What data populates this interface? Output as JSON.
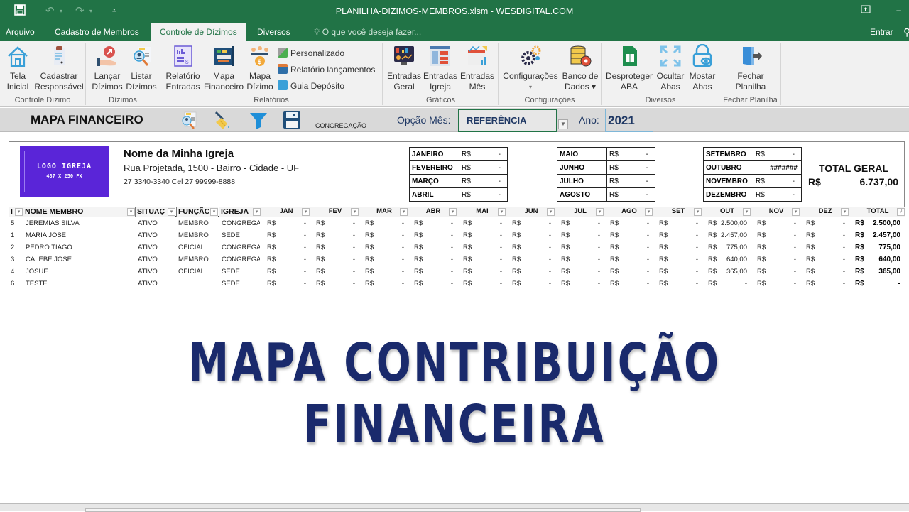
{
  "window": {
    "title": "PLANILHA-DIZIMOS-MEMBROS.xlsm - WESDIGITAL.COM",
    "qa_icons": [
      "save-icon",
      "undo-icon",
      "redo-icon",
      "customize-icon"
    ]
  },
  "tabs": [
    {
      "label": "Arquivo",
      "active": false
    },
    {
      "label": "Cadastro de Membros",
      "active": false
    },
    {
      "label": "Controle de Dízimos",
      "active": true
    },
    {
      "label": "Diversos",
      "active": false
    }
  ],
  "tell_me": "O que você deseja fazer...",
  "signin": "Entrar",
  "ribbon": {
    "groups": [
      {
        "label": "Controle Dízimo",
        "buttons": [
          {
            "line1": "Tela",
            "line2": "Inicial",
            "icon": "home-icon"
          },
          {
            "line1": "Cadastrar",
            "line2": "Responsável",
            "icon": "clipboard-icon"
          }
        ]
      },
      {
        "label": "Dízimos",
        "buttons": [
          {
            "line1": "Lançar",
            "line2": "Dízimos",
            "icon": "hand-arrow-icon"
          },
          {
            "line1": "Listar",
            "line2": "Dízimos",
            "icon": "search-profile-icon"
          }
        ]
      },
      {
        "label": "Relatórios",
        "buttons": [
          {
            "line1": "Relatório",
            "line2": "Entradas",
            "icon": "report-icon"
          },
          {
            "line1": "Mapa",
            "line2": "Financeiro",
            "icon": "map-icon"
          },
          {
            "line1": "Mapa",
            "line2": "Dízimo",
            "icon": "people-coin-icon"
          }
        ],
        "small": [
          {
            "label": "Personalizado",
            "icon": "custom-report-icon"
          },
          {
            "label": "Relatório lançamentos",
            "icon": "calendar-report-icon"
          },
          {
            "label": "Guia Depósito",
            "icon": "deposit-icon"
          }
        ]
      },
      {
        "label": "Gráficos",
        "buttons": [
          {
            "line1": "Entradas",
            "line2": "Geral",
            "icon": "monitor-chart-icon"
          },
          {
            "line1": "Entradas",
            "line2": "Igreja",
            "icon": "dashboard-icon"
          },
          {
            "line1": "Entradas",
            "line2": "Mês",
            "icon": "calendar-chart-icon"
          }
        ]
      },
      {
        "label": "Configurações",
        "buttons": [
          {
            "line1": "Configurações",
            "line2": "▾",
            "icon": "gears-icon"
          },
          {
            "line1": "Banco de",
            "line2": "Dados ▾",
            "icon": "database-gear-icon"
          }
        ]
      },
      {
        "label": "Diversos",
        "buttons": [
          {
            "line1": "Desproteger",
            "line2": "ABA",
            "icon": "sheet-icon"
          },
          {
            "line1": "Ocultar",
            "line2": "Abas",
            "icon": "expand-arrows-icon"
          },
          {
            "line1": "Mostar",
            "line2": "Abas",
            "icon": "lock-eye-icon"
          }
        ]
      },
      {
        "label": "Fechar Planilha",
        "buttons": [
          {
            "line1": "Fechar",
            "line2": "Planilha",
            "icon": "exit-door-icon"
          }
        ]
      }
    ]
  },
  "sheet_header": {
    "title": "MAPA FINANCEIRO",
    "congregacao": "CONGREGAÇÃO",
    "opcao_label": "Opção Mês:",
    "opcao_value": "REFERÊNCIA",
    "ano_label": "Ano:",
    "ano_value": "2021"
  },
  "church": {
    "logo_line1": "LOGO IGREJA",
    "logo_line2": "487 X 250 PX",
    "name": "Nome da Minha Igreja",
    "address": "Rua Projetada, 1500 - Bairro -  Cidade -  UF",
    "phone": "27 3340-3340 Cel 27 99999-8888"
  },
  "months_summary": [
    {
      "month": "JANEIRO",
      "currency": "R$",
      "value": "-"
    },
    {
      "month": "FEVEREIRO",
      "currency": "R$",
      "value": "-"
    },
    {
      "month": "MARÇO",
      "currency": "R$",
      "value": "-"
    },
    {
      "month": "ABRIL",
      "currency": "R$",
      "value": "-"
    },
    {
      "month": "MAIO",
      "currency": "R$",
      "value": "-"
    },
    {
      "month": "JUNHO",
      "currency": "R$",
      "value": "-"
    },
    {
      "month": "JULHO",
      "currency": "R$",
      "value": "-"
    },
    {
      "month": "AGOSTO",
      "currency": "R$",
      "value": "-"
    },
    {
      "month": "SETEMBRO",
      "currency": "R$",
      "value": "-"
    },
    {
      "month": "OUTUBRO",
      "currency": "",
      "value": "#######"
    },
    {
      "month": "NOVEMBRO",
      "currency": "R$",
      "value": "-"
    },
    {
      "month": "DEZEMBRO",
      "currency": "R$",
      "value": "-"
    }
  ],
  "total_geral": {
    "label": "TOTAL GERAL",
    "currency": "R$",
    "value": "6.737,00"
  },
  "table": {
    "headers": [
      "I",
      "NOME MEMBRO",
      "SITUAÇ",
      "FUNÇÃC",
      "IGREJA",
      "JAN",
      "FEV",
      "MAR",
      "ABR",
      "MAI",
      "JUN",
      "JUL",
      "AGO",
      "SET",
      "OUT",
      "NOV",
      "DEZ",
      "TOTAL"
    ],
    "currency": "R$",
    "rows": [
      {
        "id": "5",
        "nome": "JEREMIAS SILVA",
        "situacao": "ATIVO",
        "funcao": "MEMBRO",
        "igreja": "CONGREGA",
        "months": [
          "-",
          "-",
          "-",
          "-",
          "-",
          "-",
          "-",
          "-",
          "-",
          "2.500,00",
          "-",
          "-"
        ],
        "total": "2.500,00"
      },
      {
        "id": "1",
        "nome": "MARIA JOSE",
        "situacao": "ATIVO",
        "funcao": "MEMBRO",
        "igreja": "SEDE",
        "months": [
          "-",
          "-",
          "-",
          "-",
          "-",
          "-",
          "-",
          "-",
          "-",
          "2.457,00",
          "-",
          "-"
        ],
        "total": "2.457,00"
      },
      {
        "id": "2",
        "nome": "PEDRO TIAGO",
        "situacao": "ATIVO",
        "funcao": "OFICIAL",
        "igreja": "CONGREGA",
        "months": [
          "-",
          "-",
          "-",
          "-",
          "-",
          "-",
          "-",
          "-",
          "-",
          "775,00",
          "-",
          "-"
        ],
        "total": "775,00"
      },
      {
        "id": "3",
        "nome": "CALEBE JOSE",
        "situacao": "ATIVO",
        "funcao": "MEMBRO",
        "igreja": "CONGREGA",
        "months": [
          "-",
          "-",
          "-",
          "-",
          "-",
          "-",
          "-",
          "-",
          "-",
          "640,00",
          "-",
          "-"
        ],
        "total": "640,00"
      },
      {
        "id": "4",
        "nome": "JOSUÉ",
        "situacao": "ATIVO",
        "funcao": "OFICIAL",
        "igreja": "SEDE",
        "months": [
          "-",
          "-",
          "-",
          "-",
          "-",
          "-",
          "-",
          "-",
          "-",
          "365,00",
          "-",
          "-"
        ],
        "total": "365,00"
      },
      {
        "id": "6",
        "nome": "TESTE",
        "situacao": "ATIVO",
        "funcao": "",
        "igreja": "SEDE",
        "months": [
          "-",
          "-",
          "-",
          "-",
          "-",
          "-",
          "-",
          "-",
          "-",
          "-",
          "-",
          "-"
        ],
        "total": "-"
      }
    ]
  },
  "overlay": {
    "line1": "MAPA CONTRIBUIÇÃO",
    "line2": "FINANCEIRA"
  },
  "colors": {
    "excel_green": "#217346",
    "heading_navy": "#1a2a6c",
    "logo_purple": "#5a25d8"
  }
}
